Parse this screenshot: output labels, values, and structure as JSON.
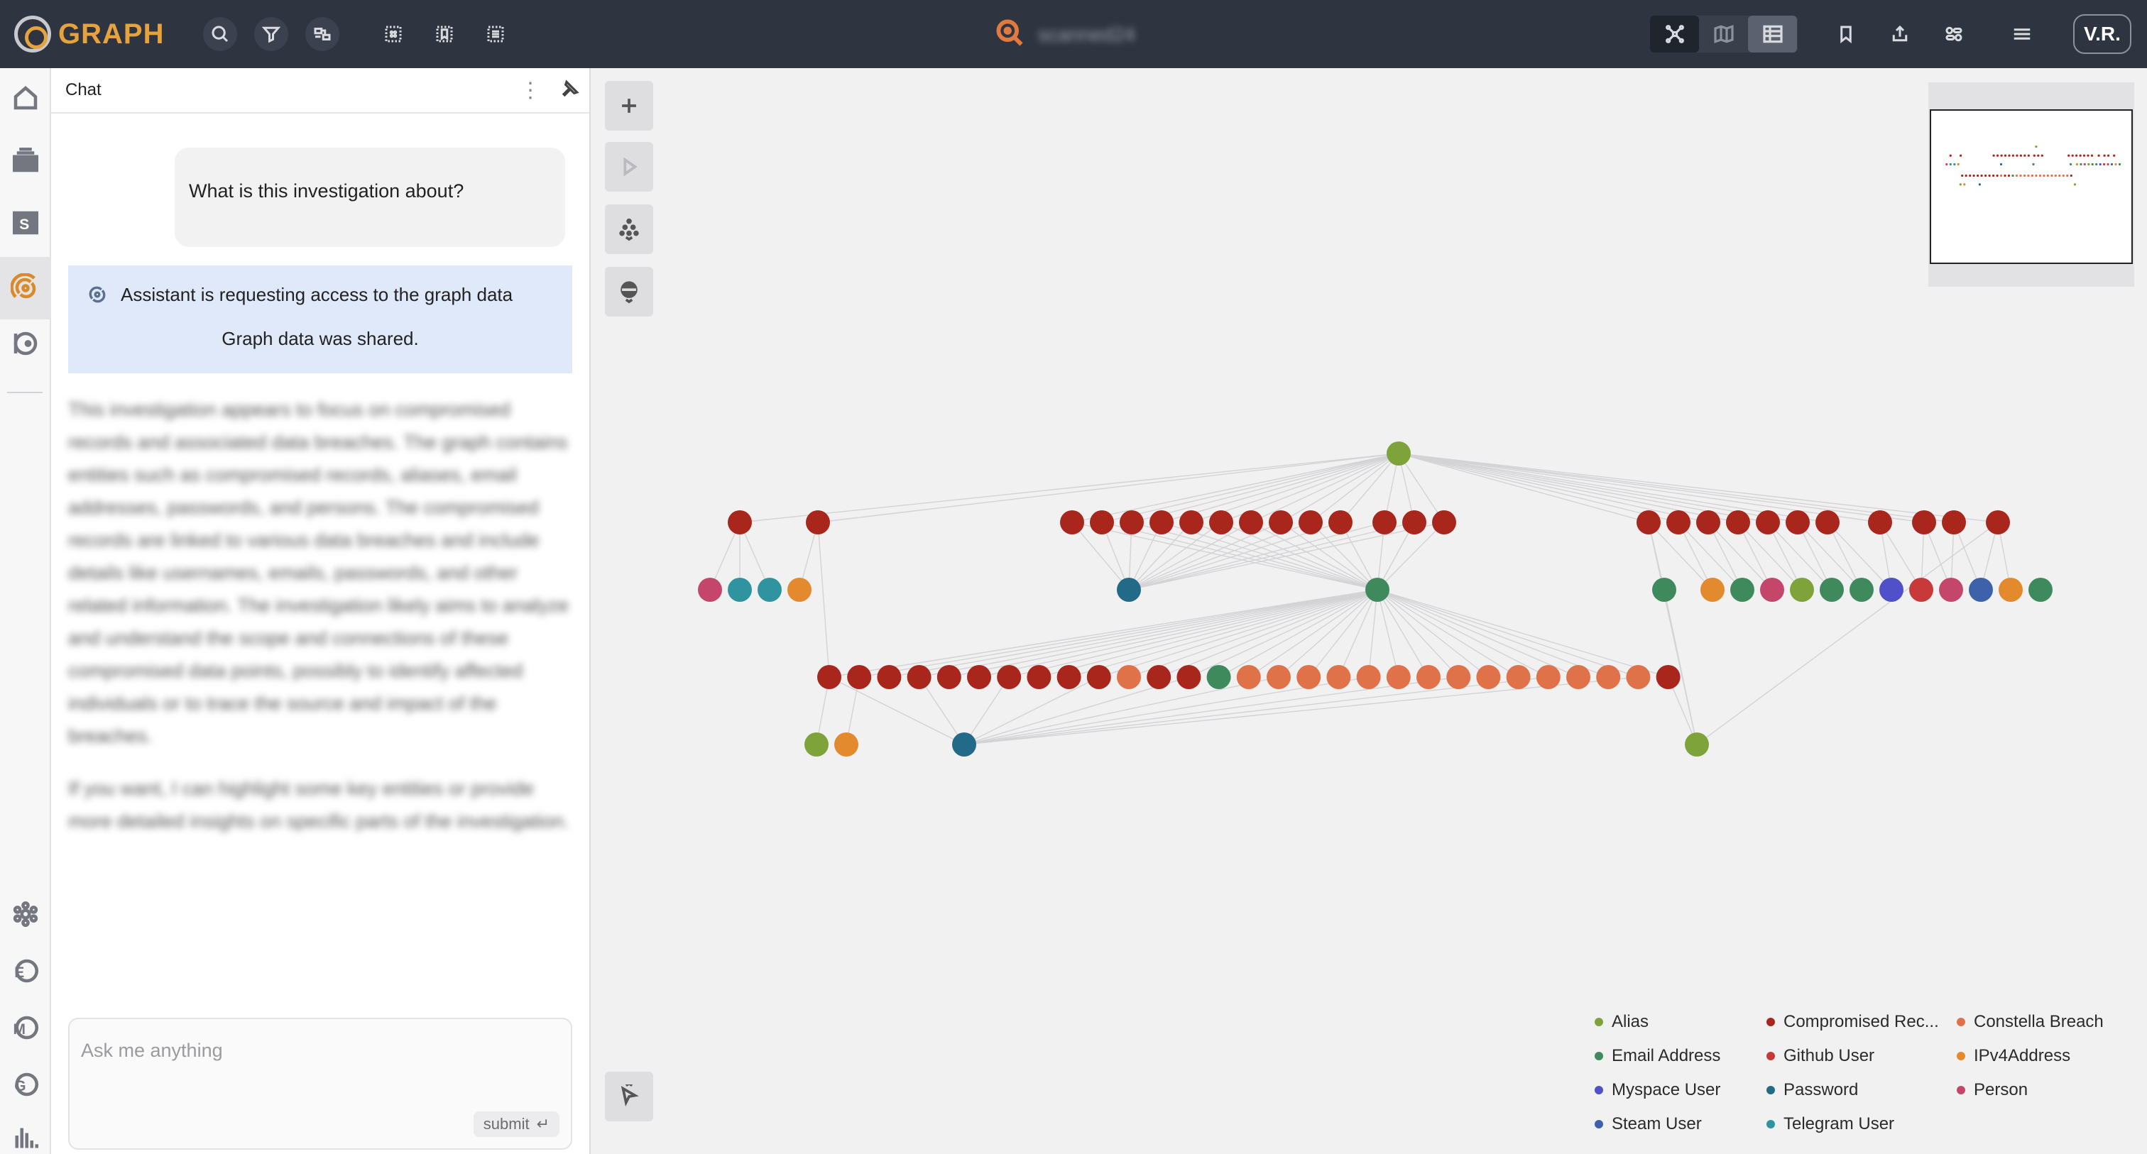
{
  "app": {
    "logo_text": "GRAPH",
    "investigation_name": "scanned24",
    "user_initials": "V.R.",
    "accent": "#e6a23c"
  },
  "toolbar_left": [
    {
      "name": "search-button",
      "icon": "search-icon"
    },
    {
      "name": "filter-button",
      "icon": "filter-icon"
    },
    {
      "name": "layout-button",
      "icon": "layout-icon"
    },
    {
      "name": "select-all-button",
      "icon": "select-all-icon"
    },
    {
      "name": "bookmark-select-button",
      "icon": "bookmark-select-icon"
    },
    {
      "name": "list-select-button",
      "icon": "list-select-icon"
    }
  ],
  "toolbar_right": [
    {
      "name": "bookmark-button",
      "icon": "bookmark-icon"
    },
    {
      "name": "export-button",
      "icon": "upload-icon"
    },
    {
      "name": "toggle-panels-button",
      "icon": "toggles-icon"
    },
    {
      "name": "menu-button",
      "icon": "hamburger-icon"
    }
  ],
  "views": [
    {
      "name": "graph-view-button",
      "icon": "graph-icon",
      "active": true
    },
    {
      "name": "map-view-button",
      "icon": "map-icon",
      "active": false
    },
    {
      "name": "table-view-button",
      "icon": "table-icon",
      "active": false
    }
  ],
  "rail": {
    "top": [
      "home-icon",
      "layers-icon",
      "s-app-icon",
      "radar-icon",
      "timeline-icon"
    ],
    "bottom": [
      "settings-icon",
      "e-app-icon",
      "m-app-icon",
      "g-app-icon",
      "chart-icon"
    ]
  },
  "chat": {
    "title": "Chat",
    "user_message": "What is this investigation about?",
    "assistant_request": "Assistant is requesting access to the graph data",
    "assistant_shared": "Graph data was shared.",
    "reply_paragraph_1": "This investigation appears to focus on compromised records and associated data breaches. The graph contains entities such as compromised records, aliases, email addresses, passwords, and persons. The compromised records are linked to various data breaches and include details like usernames, emails, passwords, and other related information. The investigation likely aims to analyze and understand the scope and connections of these compromised data points, possibly to identify affected individuals or to trace the source and impact of the breaches.",
    "reply_paragraph_2": "If you want, I can highlight some key entities or provide more detailed insights on specific parts of the investigation.",
    "input_placeholder": "Ask me anything",
    "submit_label": "submit",
    "submit_icon": "↵"
  },
  "legend": [
    {
      "label": "Alias",
      "color": "#7da33a"
    },
    {
      "label": "Compromised Rec...",
      "color": "#a8261c"
    },
    {
      "label": "Constella Breach",
      "color": "#e0724a"
    },
    {
      "label": "Email Address",
      "color": "#3f8a5c"
    },
    {
      "label": "Github User",
      "color": "#c83a3a"
    },
    {
      "label": "IPv4Address",
      "color": "#e48a2e"
    },
    {
      "label": "Myspace User",
      "color": "#5050c8"
    },
    {
      "label": "Password",
      "color": "#236a88"
    },
    {
      "label": "Person",
      "color": "#c4466a"
    },
    {
      "label": "Steam User",
      "color": "#3d62aa"
    },
    {
      "label": "Telegram User",
      "color": "#2f93a0"
    }
  ]
}
